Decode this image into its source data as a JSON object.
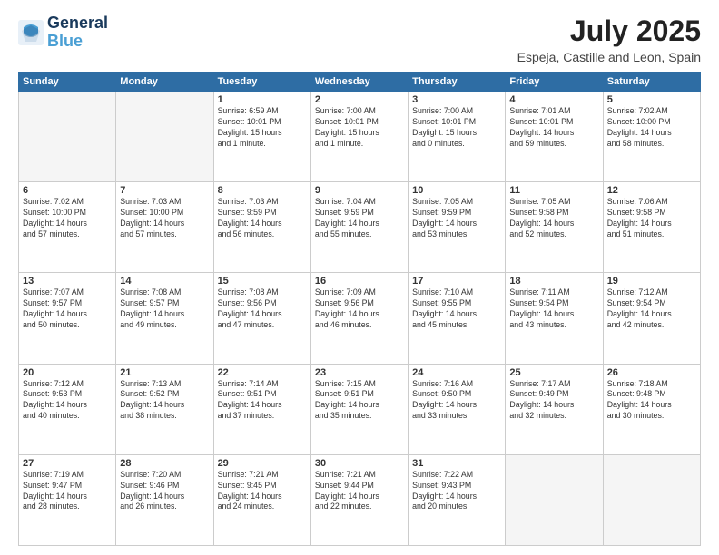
{
  "header": {
    "logo_line1": "General",
    "logo_line2": "Blue",
    "month": "July 2025",
    "location": "Espeja, Castille and Leon, Spain"
  },
  "weekdays": [
    "Sunday",
    "Monday",
    "Tuesday",
    "Wednesday",
    "Thursday",
    "Friday",
    "Saturday"
  ],
  "weeks": [
    [
      {
        "day": "",
        "empty": true
      },
      {
        "day": "",
        "empty": true
      },
      {
        "day": "1",
        "info": "Sunrise: 6:59 AM\nSunset: 10:01 PM\nDaylight: 15 hours\nand 1 minute."
      },
      {
        "day": "2",
        "info": "Sunrise: 7:00 AM\nSunset: 10:01 PM\nDaylight: 15 hours\nand 1 minute."
      },
      {
        "day": "3",
        "info": "Sunrise: 7:00 AM\nSunset: 10:01 PM\nDaylight: 15 hours\nand 0 minutes."
      },
      {
        "day": "4",
        "info": "Sunrise: 7:01 AM\nSunset: 10:01 PM\nDaylight: 14 hours\nand 59 minutes."
      },
      {
        "day": "5",
        "info": "Sunrise: 7:02 AM\nSunset: 10:00 PM\nDaylight: 14 hours\nand 58 minutes."
      }
    ],
    [
      {
        "day": "6",
        "info": "Sunrise: 7:02 AM\nSunset: 10:00 PM\nDaylight: 14 hours\nand 57 minutes."
      },
      {
        "day": "7",
        "info": "Sunrise: 7:03 AM\nSunset: 10:00 PM\nDaylight: 14 hours\nand 57 minutes."
      },
      {
        "day": "8",
        "info": "Sunrise: 7:03 AM\nSunset: 9:59 PM\nDaylight: 14 hours\nand 56 minutes."
      },
      {
        "day": "9",
        "info": "Sunrise: 7:04 AM\nSunset: 9:59 PM\nDaylight: 14 hours\nand 55 minutes."
      },
      {
        "day": "10",
        "info": "Sunrise: 7:05 AM\nSunset: 9:59 PM\nDaylight: 14 hours\nand 53 minutes."
      },
      {
        "day": "11",
        "info": "Sunrise: 7:05 AM\nSunset: 9:58 PM\nDaylight: 14 hours\nand 52 minutes."
      },
      {
        "day": "12",
        "info": "Sunrise: 7:06 AM\nSunset: 9:58 PM\nDaylight: 14 hours\nand 51 minutes."
      }
    ],
    [
      {
        "day": "13",
        "info": "Sunrise: 7:07 AM\nSunset: 9:57 PM\nDaylight: 14 hours\nand 50 minutes."
      },
      {
        "day": "14",
        "info": "Sunrise: 7:08 AM\nSunset: 9:57 PM\nDaylight: 14 hours\nand 49 minutes."
      },
      {
        "day": "15",
        "info": "Sunrise: 7:08 AM\nSunset: 9:56 PM\nDaylight: 14 hours\nand 47 minutes."
      },
      {
        "day": "16",
        "info": "Sunrise: 7:09 AM\nSunset: 9:56 PM\nDaylight: 14 hours\nand 46 minutes."
      },
      {
        "day": "17",
        "info": "Sunrise: 7:10 AM\nSunset: 9:55 PM\nDaylight: 14 hours\nand 45 minutes."
      },
      {
        "day": "18",
        "info": "Sunrise: 7:11 AM\nSunset: 9:54 PM\nDaylight: 14 hours\nand 43 minutes."
      },
      {
        "day": "19",
        "info": "Sunrise: 7:12 AM\nSunset: 9:54 PM\nDaylight: 14 hours\nand 42 minutes."
      }
    ],
    [
      {
        "day": "20",
        "info": "Sunrise: 7:12 AM\nSunset: 9:53 PM\nDaylight: 14 hours\nand 40 minutes."
      },
      {
        "day": "21",
        "info": "Sunrise: 7:13 AM\nSunset: 9:52 PM\nDaylight: 14 hours\nand 38 minutes."
      },
      {
        "day": "22",
        "info": "Sunrise: 7:14 AM\nSunset: 9:51 PM\nDaylight: 14 hours\nand 37 minutes."
      },
      {
        "day": "23",
        "info": "Sunrise: 7:15 AM\nSunset: 9:51 PM\nDaylight: 14 hours\nand 35 minutes."
      },
      {
        "day": "24",
        "info": "Sunrise: 7:16 AM\nSunset: 9:50 PM\nDaylight: 14 hours\nand 33 minutes."
      },
      {
        "day": "25",
        "info": "Sunrise: 7:17 AM\nSunset: 9:49 PM\nDaylight: 14 hours\nand 32 minutes."
      },
      {
        "day": "26",
        "info": "Sunrise: 7:18 AM\nSunset: 9:48 PM\nDaylight: 14 hours\nand 30 minutes."
      }
    ],
    [
      {
        "day": "27",
        "info": "Sunrise: 7:19 AM\nSunset: 9:47 PM\nDaylight: 14 hours\nand 28 minutes."
      },
      {
        "day": "28",
        "info": "Sunrise: 7:20 AM\nSunset: 9:46 PM\nDaylight: 14 hours\nand 26 minutes."
      },
      {
        "day": "29",
        "info": "Sunrise: 7:21 AM\nSunset: 9:45 PM\nDaylight: 14 hours\nand 24 minutes."
      },
      {
        "day": "30",
        "info": "Sunrise: 7:21 AM\nSunset: 9:44 PM\nDaylight: 14 hours\nand 22 minutes."
      },
      {
        "day": "31",
        "info": "Sunrise: 7:22 AM\nSunset: 9:43 PM\nDaylight: 14 hours\nand 20 minutes."
      },
      {
        "day": "",
        "empty": true
      },
      {
        "day": "",
        "empty": true
      }
    ]
  ]
}
